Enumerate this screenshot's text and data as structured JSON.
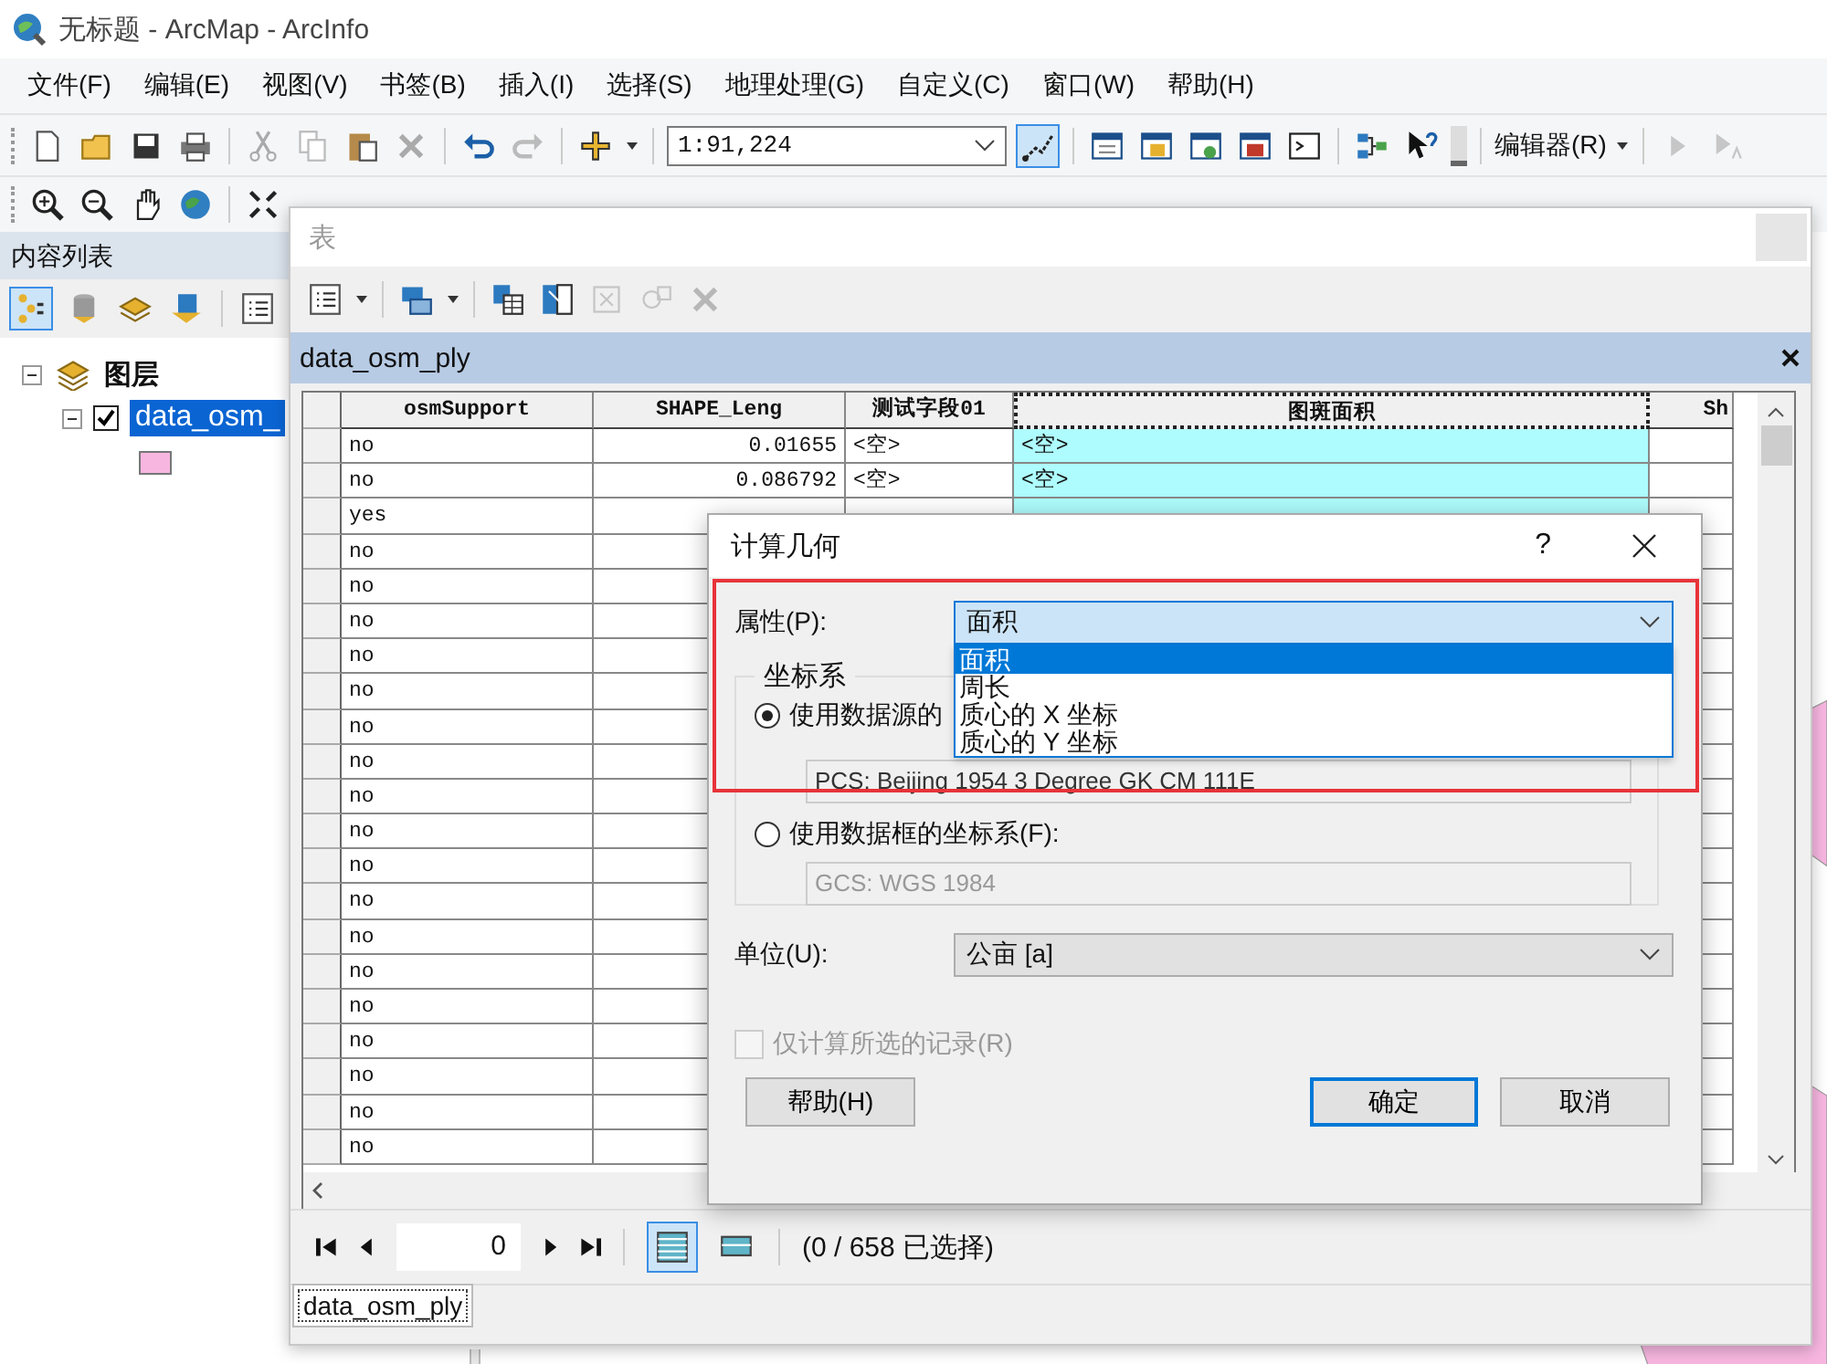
{
  "window": {
    "title": "无标题 - ArcMap - ArcInfo"
  },
  "menu": [
    "文件(F)",
    "编辑(E)",
    "视图(V)",
    "书签(B)",
    "插入(I)",
    "选择(S)",
    "地理处理(G)",
    "自定义(C)",
    "窗口(W)",
    "帮助(H)"
  ],
  "toolbar": {
    "scale": "1:91,224",
    "editor_menu": "编辑器(R)"
  },
  "toc": {
    "title": "内容列表",
    "group": {
      "name": "图层",
      "expanded": true
    },
    "layer": {
      "name": "data_osm_",
      "expanded": true,
      "checked": true,
      "selected": true,
      "color": "#f7b6e0"
    }
  },
  "table_window": {
    "title": "表",
    "tab": "data_osm_ply",
    "columns": [
      {
        "name": "osmSupport",
        "selected": false
      },
      {
        "name": "SHAPE_Leng",
        "selected": false
      },
      {
        "name": "测试字段01",
        "selected": false
      },
      {
        "name": "图斑面积",
        "selected": true
      },
      {
        "name": "Sh",
        "selected": false
      }
    ],
    "rows": [
      [
        "no",
        "0.01655",
        "<空>",
        "<空>"
      ],
      [
        "no",
        "0.086792",
        "<空>",
        "<空>"
      ],
      [
        "yes"
      ],
      [
        "no"
      ],
      [
        "no"
      ],
      [
        "no"
      ],
      [
        "no"
      ],
      [
        "no"
      ],
      [
        "no"
      ],
      [
        "no"
      ],
      [
        "no"
      ],
      [
        "no"
      ],
      [
        "no"
      ],
      [
        "no"
      ],
      [
        "no"
      ],
      [
        "no"
      ],
      [
        "no"
      ],
      [
        "no"
      ],
      [
        "no"
      ],
      [
        "no"
      ],
      [
        "no"
      ]
    ],
    "record": "0",
    "selection_status": "(0 / 658 已选择)",
    "bottom_tab": "data_osm_ply"
  },
  "dialog": {
    "title": "计算几何",
    "help_mark": "?",
    "property_label": "属性(P):",
    "property_value": "面积",
    "options": [
      {
        "label": "面积",
        "selected": true
      },
      {
        "label": "周长",
        "selected": false
      },
      {
        "label": "质心的 X 坐标",
        "selected": false
      },
      {
        "label": "质心的 Y 坐标",
        "selected": false
      }
    ],
    "coord_group": "坐标系",
    "coord_options": [
      {
        "label": "使用数据源的",
        "selected": true,
        "system": "PCS: Beijing 1954 3 Degree GK CM 111E"
      },
      {
        "label": "使用数据框的坐标系(F):",
        "selected": false,
        "system": "GCS: WGS 1984"
      }
    ],
    "unit_label": "单位(U):",
    "unit_value": "公亩 [a]",
    "selected_only": {
      "label": "仅计算所选的记录(R)",
      "checked": false,
      "disabled": true
    },
    "buttons": [
      {
        "label": "帮助(H)",
        "default": false
      },
      {
        "label": "确定",
        "default": true
      },
      {
        "label": "取消",
        "default": false
      }
    ]
  }
}
